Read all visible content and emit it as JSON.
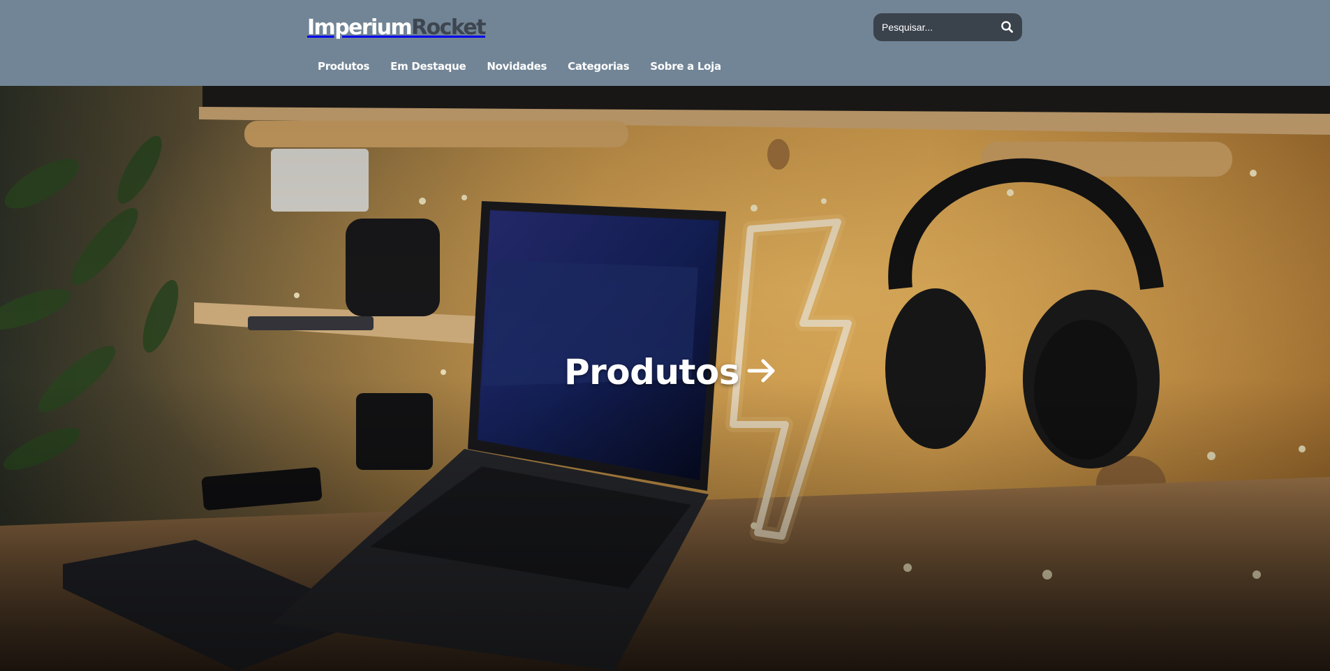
{
  "header": {
    "logo": {
      "part1": "Imperium",
      "part2": "Rocket"
    },
    "search": {
      "placeholder": "Pesquisar..."
    },
    "nav": [
      {
        "label": "Produtos"
      },
      {
        "label": "Em Destaque"
      },
      {
        "label": "Novidades"
      },
      {
        "label": "Categorias"
      },
      {
        "label": "Sobre a Loja"
      }
    ]
  },
  "hero": {
    "cta_label": "Produtos",
    "cta_icon": "arrow-right-icon",
    "image_subject": "desk-setup-photo"
  },
  "colors": {
    "header_bg": "#728596",
    "logo_primary": "#ffffff",
    "logo_secondary": "#3d4650",
    "search_bg": "#3a424c",
    "text": "#ffffff"
  }
}
